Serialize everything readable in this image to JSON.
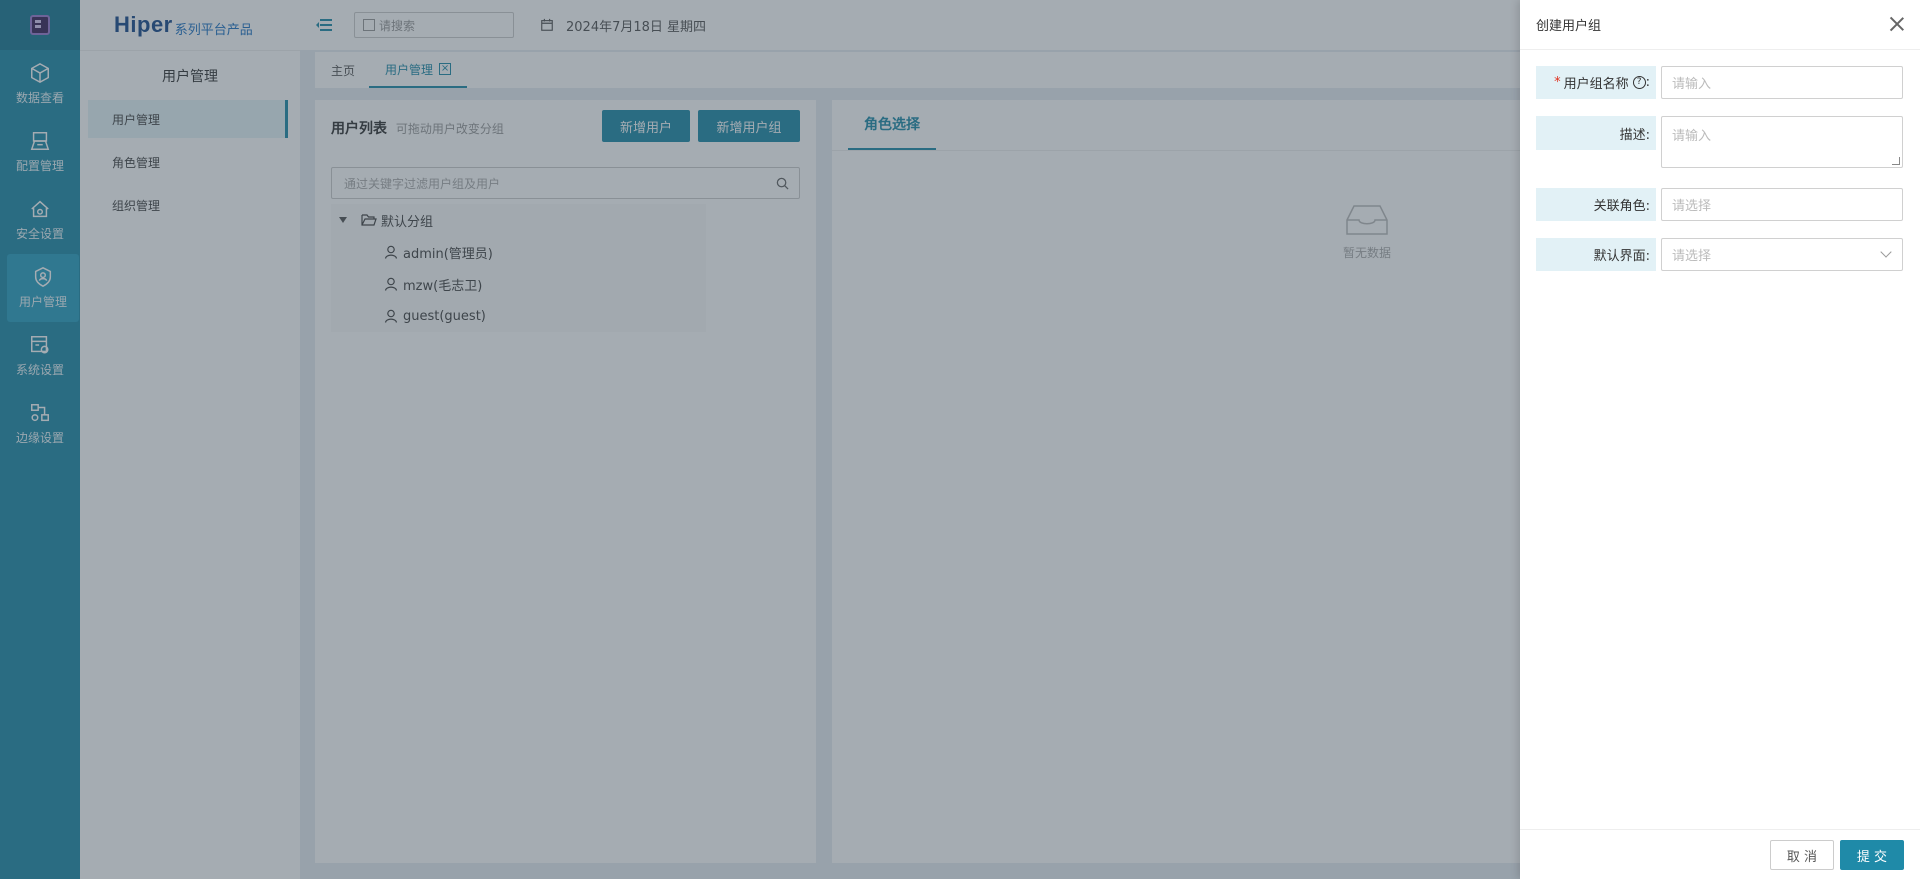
{
  "brand": {
    "main": "Hiper",
    "sub": "系列平台产品"
  },
  "rail": {
    "items": [
      {
        "label": "数据查看",
        "icon": "cube-icon"
      },
      {
        "label": "配置管理",
        "icon": "config-icon"
      },
      {
        "label": "安全设置",
        "icon": "home-shield-icon"
      },
      {
        "label": "用户管理",
        "icon": "user-shield-icon",
        "active": true
      },
      {
        "label": "系统设置",
        "icon": "system-settings-icon"
      },
      {
        "label": "边缘设置",
        "icon": "edge-icon"
      }
    ]
  },
  "submenu": {
    "title": "用户管理",
    "items": [
      "用户管理",
      "角色管理",
      "组织管理"
    ]
  },
  "header": {
    "search_placeholder": "请搜索",
    "date": "2024年7月18日 星期四"
  },
  "tabs": {
    "home": "主页",
    "active": "用户管理",
    "close": "×"
  },
  "user_panel": {
    "title": "用户列表",
    "hint": "可拖动用户改变分组",
    "add_user": "新增用户",
    "add_group": "新增用户组",
    "filter_placeholder": "通过关键字过滤用户组及用户",
    "group": "默认分组",
    "users": [
      "admin(管理员)",
      "mzw(毛志卫)",
      "guest(guest)"
    ]
  },
  "role_panel": {
    "tab": "角色选择",
    "empty": "暂无数据"
  },
  "drawer": {
    "title": "创建用户组",
    "fields": {
      "name_label": "用户组名称",
      "name_placeholder": "请输入",
      "desc_label": "描述:",
      "desc_placeholder": "请输入",
      "role_label": "关联角色:",
      "role_placeholder": "请选择",
      "view_label": "默认界面:",
      "view_placeholder": "请选择"
    },
    "required_mark": "*",
    "help_mark": "?",
    "colon": ":",
    "cancel": "取 消",
    "submit": "提 交"
  },
  "colors": {
    "primary": "#1f8aa8",
    "rail": "#1f8aa8",
    "label_bg": "#e2f1f6"
  }
}
